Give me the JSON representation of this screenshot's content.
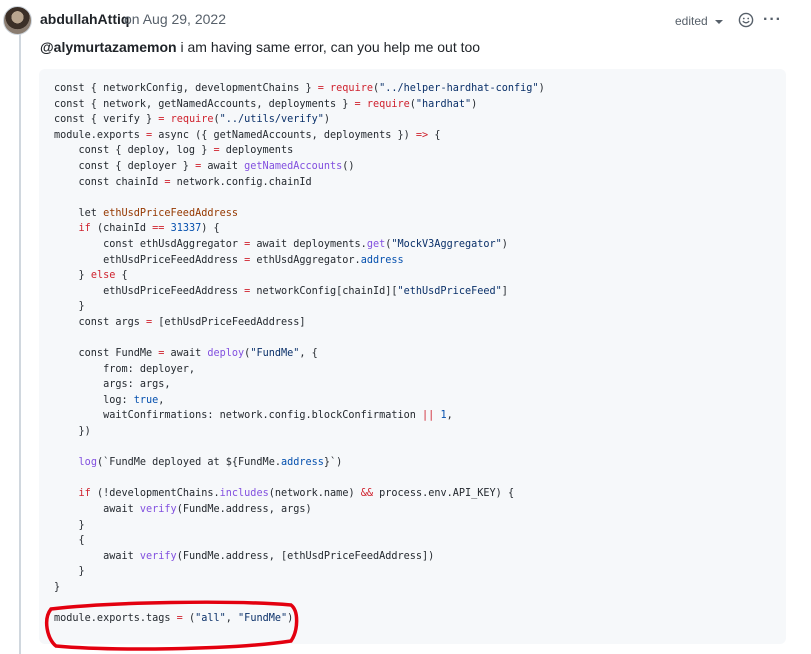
{
  "comment": {
    "author": "abdullahAttiq",
    "date": "on Aug 29, 2022",
    "edited_label": "edited",
    "mention": "@alymurtazamemon",
    "text": " i am having same error, can you help me out too",
    "icons": [
      "avatar",
      "chevron-down-icon",
      "smiley-icon",
      "kebab-menu-icon"
    ]
  },
  "code_lines": [
    [
      [
        "const { networkConfig, developmentChains } ",
        ""
      ],
      [
        "=",
        "k"
      ],
      [
        " ",
        ""
      ],
      [
        "require",
        "k"
      ],
      [
        "(",
        ""
      ],
      [
        "\"../helper-hardhat-config\"",
        "s"
      ],
      [
        ")",
        ""
      ]
    ],
    [
      [
        "const { network, getNamedAccounts, deployments } ",
        ""
      ],
      [
        "=",
        "k"
      ],
      [
        " ",
        ""
      ],
      [
        "require",
        "k"
      ],
      [
        "(",
        ""
      ],
      [
        "\"hardhat\"",
        "s"
      ],
      [
        ")",
        ""
      ]
    ],
    [
      [
        "const { verify } ",
        ""
      ],
      [
        "=",
        "k"
      ],
      [
        " ",
        ""
      ],
      [
        "require",
        "k"
      ],
      [
        "(",
        ""
      ],
      [
        "\"../utils/verify\"",
        "s"
      ],
      [
        ")",
        ""
      ]
    ],
    [
      [
        "module.exports ",
        ""
      ],
      [
        "=",
        "k"
      ],
      [
        " async ({ getNamedAccounts, deployments }) ",
        ""
      ],
      [
        "=>",
        "k"
      ],
      [
        " {",
        ""
      ]
    ],
    [
      [
        "    const { deploy, log } ",
        ""
      ],
      [
        "=",
        "k"
      ],
      [
        " deployments",
        ""
      ]
    ],
    [
      [
        "    const { deployer } ",
        ""
      ],
      [
        "=",
        "k"
      ],
      [
        " await ",
        ""
      ],
      [
        "getNamedAccounts",
        "f"
      ],
      [
        "()",
        ""
      ]
    ],
    [
      [
        "    const chainId ",
        ""
      ],
      [
        "=",
        "k"
      ],
      [
        " network.config.chainId",
        ""
      ]
    ],
    [],
    [
      [
        "    let ",
        ""
      ],
      [
        "ethUsdPriceFeedAddress",
        "v"
      ]
    ],
    [
      [
        "    ",
        ""
      ],
      [
        "if",
        "k"
      ],
      [
        " (chainId ",
        ""
      ],
      [
        "==",
        "k"
      ],
      [
        " ",
        ""
      ],
      [
        "31337",
        "n"
      ],
      [
        ") {",
        ""
      ]
    ],
    [
      [
        "        const ethUsdAggregator ",
        ""
      ],
      [
        "=",
        "k"
      ],
      [
        " await deployments.",
        ""
      ],
      [
        "get",
        "f"
      ],
      [
        "(",
        ""
      ],
      [
        "\"MockV3Aggregator\"",
        "s"
      ],
      [
        ")",
        ""
      ]
    ],
    [
      [
        "        ethUsdPriceFeedAddress ",
        ""
      ],
      [
        "=",
        "k"
      ],
      [
        " ethUsdAggregator.",
        ""
      ],
      [
        "address",
        "n"
      ]
    ],
    [
      [
        "    } ",
        ""
      ],
      [
        "else",
        "k"
      ],
      [
        " {",
        ""
      ]
    ],
    [
      [
        "        ethUsdPriceFeedAddress ",
        ""
      ],
      [
        "=",
        "k"
      ],
      [
        " networkConfig[chainId][",
        ""
      ],
      [
        "\"ethUsdPriceFeed\"",
        "s"
      ],
      [
        "]",
        ""
      ]
    ],
    [
      [
        "    }",
        ""
      ]
    ],
    [
      [
        "    const args ",
        ""
      ],
      [
        "=",
        "k"
      ],
      [
        " [ethUsdPriceFeedAddress]",
        ""
      ]
    ],
    [],
    [
      [
        "    const FundMe ",
        ""
      ],
      [
        "=",
        "k"
      ],
      [
        " await ",
        ""
      ],
      [
        "deploy",
        "f"
      ],
      [
        "(",
        ""
      ],
      [
        "\"FundMe\"",
        "s"
      ],
      [
        ", {",
        ""
      ]
    ],
    [
      [
        "        from: deployer,",
        ""
      ]
    ],
    [
      [
        "        args: args,",
        ""
      ]
    ],
    [
      [
        "        log: ",
        ""
      ],
      [
        "true",
        "n"
      ],
      [
        ",",
        ""
      ]
    ],
    [
      [
        "        waitConfirmations: network.config.blockConfirmation ",
        ""
      ],
      [
        "||",
        "k"
      ],
      [
        " ",
        ""
      ],
      [
        "1",
        "n"
      ],
      [
        ",",
        ""
      ]
    ],
    [
      [
        "    })",
        ""
      ]
    ],
    [],
    [
      [
        "    ",
        ""
      ],
      [
        "log",
        "f"
      ],
      [
        "(`FundMe deployed at ${FundMe.",
        ""
      ],
      [
        "address",
        "n"
      ],
      [
        "}`)",
        ""
      ]
    ],
    [],
    [
      [
        "    ",
        ""
      ],
      [
        "if",
        "k"
      ],
      [
        " (!developmentChains.",
        ""
      ],
      [
        "includes",
        "f"
      ],
      [
        "(network.name) ",
        ""
      ],
      [
        "&&",
        "k"
      ],
      [
        " process.env.API_KEY) {",
        ""
      ]
    ],
    [
      [
        "        await ",
        ""
      ],
      [
        "verify",
        "f"
      ],
      [
        "(FundMe.address, args)",
        ""
      ]
    ],
    [
      [
        "    }",
        ""
      ]
    ],
    [
      [
        "    {",
        ""
      ]
    ],
    [
      [
        "        await ",
        ""
      ],
      [
        "verify",
        "f"
      ],
      [
        "(FundMe.address, [ethUsdPriceFeedAddress])",
        ""
      ]
    ],
    [
      [
        "    }",
        ""
      ]
    ],
    [
      [
        "}",
        ""
      ]
    ],
    [],
    [
      [
        "module.exports.tags ",
        ""
      ],
      [
        "=",
        "k"
      ],
      [
        " (",
        ""
      ],
      [
        "\"all\"",
        "s"
      ],
      [
        ", ",
        ""
      ],
      [
        "\"FundMe\"",
        "s"
      ],
      [
        ")",
        ""
      ]
    ]
  ],
  "colors": {
    "keyword": "#cf222e",
    "string": "#0a3069",
    "function": "#8250df",
    "constant": "#0550ae",
    "variable": "#953800",
    "code_background": "#f6f8fa",
    "annotation": "#e3000f"
  }
}
